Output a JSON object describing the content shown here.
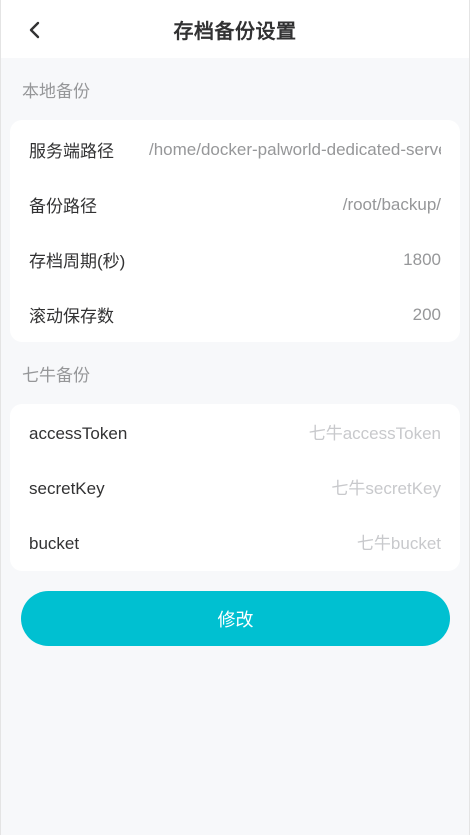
{
  "header": {
    "title": "存档备份设置",
    "back_icon": "chevron-left-icon"
  },
  "local_backup": {
    "section_title": "本地备份",
    "fields": [
      {
        "label": "服务端路径",
        "value": "/home/docker-palworld-dedicated-server",
        "placeholder": ""
      },
      {
        "label": "备份路径",
        "value": "/root/backup/",
        "placeholder": ""
      },
      {
        "label": "存档周期(秒)",
        "value": "1800",
        "placeholder": ""
      },
      {
        "label": "滚动保存数",
        "value": "200",
        "placeholder": ""
      }
    ]
  },
  "qiniu_backup": {
    "section_title": "七牛备份",
    "fields": [
      {
        "label": "accessToken",
        "value": "",
        "placeholder": "七牛accessToken"
      },
      {
        "label": "secretKey",
        "value": "",
        "placeholder": "七牛secretKey"
      },
      {
        "label": "bucket",
        "value": "",
        "placeholder": "七牛bucket"
      }
    ]
  },
  "actions": {
    "submit_label": "修改"
  },
  "colors": {
    "primary": "#00c0d1",
    "background": "#f7f8fa",
    "text": "#323233",
    "muted": "#969799",
    "placeholder": "#c8c9cc"
  }
}
